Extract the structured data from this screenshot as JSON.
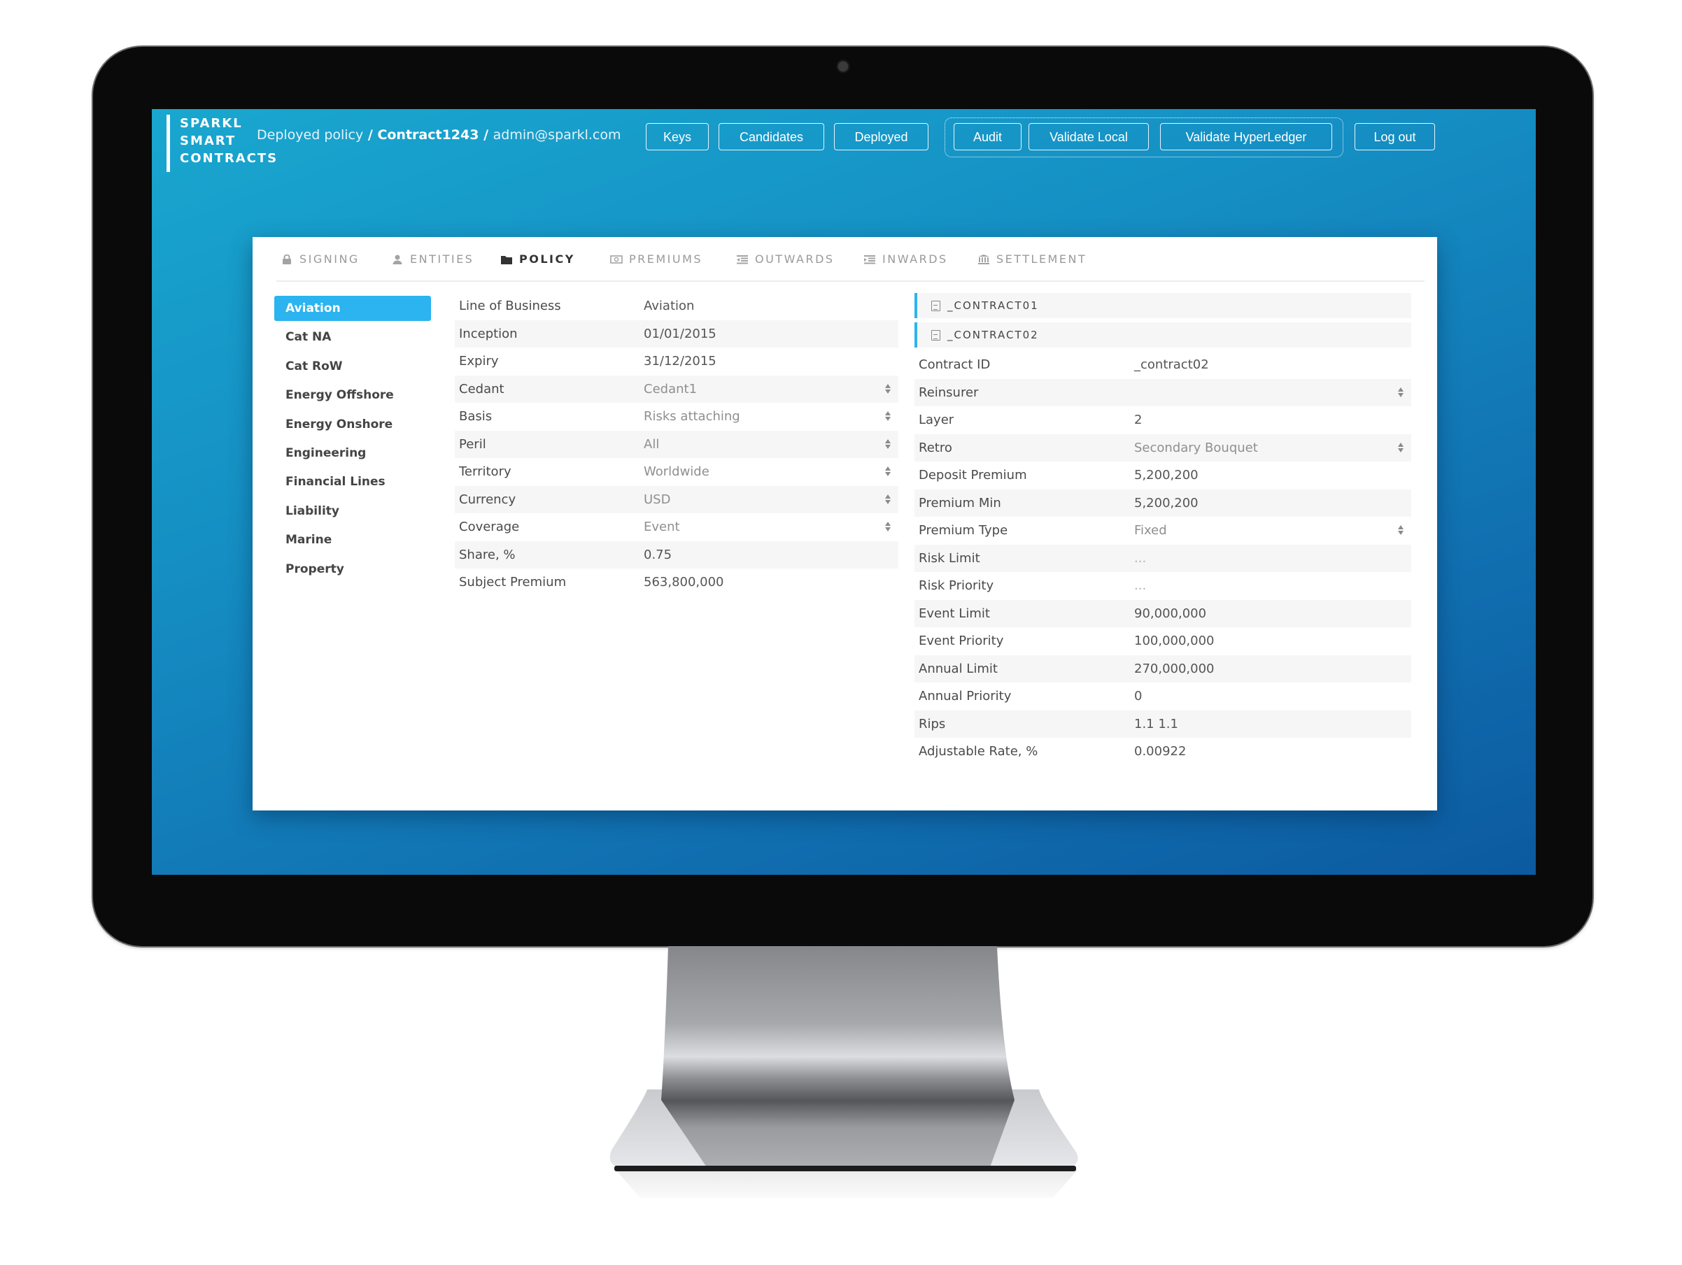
{
  "brand": {
    "line1": "SPARKL",
    "line2": "SMART",
    "line3": "CONTRACTS"
  },
  "breadcrumb": {
    "section": "Deployed policy",
    "sep": " / ",
    "contract": "Contract1243",
    "user": "admin@sparkl.com"
  },
  "nav": {
    "keys": "Keys",
    "candidates": "Candidates",
    "deployed": "Deployed",
    "audit": "Audit",
    "validate_local": "Validate Local",
    "validate_hyperledger": "Validate HyperLedger",
    "logout": "Log out"
  },
  "tabs": [
    {
      "label": "SIGNING",
      "icon": "lock-icon"
    },
    {
      "label": "ENTITIES",
      "icon": "user-icon"
    },
    {
      "label": "POLICY",
      "icon": "folder-icon",
      "active": true
    },
    {
      "label": "PREMIUMS",
      "icon": "money-icon"
    },
    {
      "label": "OUTWARDS",
      "icon": "outdent-icon"
    },
    {
      "label": "INWARDS",
      "icon": "indent-icon"
    },
    {
      "label": "SETTLEMENT",
      "icon": "bank-icon"
    }
  ],
  "sidebar": {
    "items": [
      {
        "label": "Aviation",
        "active": true
      },
      {
        "label": "Cat NA"
      },
      {
        "label": "Cat RoW"
      },
      {
        "label": "Energy Offshore"
      },
      {
        "label": "Energy Onshore"
      },
      {
        "label": "Engineering"
      },
      {
        "label": "Financial Lines"
      },
      {
        "label": "Liability"
      },
      {
        "label": "Marine"
      },
      {
        "label": "Property"
      }
    ]
  },
  "policy": {
    "fields": [
      {
        "label": "Line of Business",
        "value": "Aviation"
      },
      {
        "label": "Inception",
        "value": "01/01/2015"
      },
      {
        "label": "Expiry",
        "value": "31/12/2015"
      },
      {
        "label": "Cedant",
        "value": "Cedant1",
        "select": true
      },
      {
        "label": "Basis",
        "value": "Risks attaching",
        "select": true
      },
      {
        "label": "Peril",
        "value": "All",
        "select": true
      },
      {
        "label": "Territory",
        "value": "Worldwide",
        "select": true
      },
      {
        "label": "Currency",
        "value": "USD",
        "select": true
      },
      {
        "label": "Coverage",
        "value": "Event",
        "select": true
      },
      {
        "label": "Share, %",
        "value": "0.75"
      },
      {
        "label": "Subject Premium",
        "value": "563,800,000"
      }
    ]
  },
  "contracts": {
    "items": [
      {
        "label": "_CONTRACT01"
      },
      {
        "label": "_CONTRACT02"
      }
    ],
    "fields": [
      {
        "label": "Contract ID",
        "value": "_contract02"
      },
      {
        "label": "Reinsurer",
        "value": "",
        "select": true
      },
      {
        "label": "Layer",
        "value": "2"
      },
      {
        "label": "Retro",
        "value": "Secondary Bouquet",
        "select": true
      },
      {
        "label": "Deposit Premium",
        "value": "5,200,200"
      },
      {
        "label": "Premium Min",
        "value": "5,200,200"
      },
      {
        "label": "Premium Type",
        "value": "Fixed",
        "select": true
      },
      {
        "label": "Risk Limit",
        "value": "...",
        "placeholder": true
      },
      {
        "label": "Risk Priority",
        "value": "...",
        "placeholder": true
      },
      {
        "label": "Event Limit",
        "value": "90,000,000"
      },
      {
        "label": "Event Priority",
        "value": "100,000,000"
      },
      {
        "label": "Annual Limit",
        "value": "270,000,000"
      },
      {
        "label": "Annual Priority",
        "value": "0"
      },
      {
        "label": "Rips",
        "value": "1.1 1.1"
      },
      {
        "label": "Adjustable Rate, %",
        "value": "0.00922"
      }
    ]
  },
  "colors": {
    "accent": "#2bb4ef",
    "screen_top": "#19a7cf",
    "screen_bottom": "#0c5aa0",
    "bezel": "#0a0a0a"
  }
}
